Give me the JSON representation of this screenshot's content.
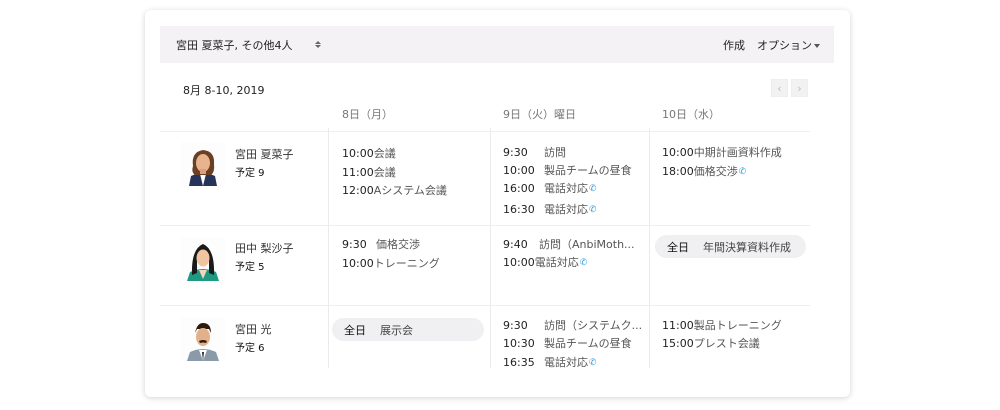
{
  "toolbar": {
    "people": "宮田 夏菜子, その他4人",
    "create": "作成",
    "options": "オプション"
  },
  "calendar": {
    "range": "8月 8-10, 2019",
    "prev": "‹",
    "next": "›",
    "days": [
      "8日（月）",
      "9日（火）曜日",
      "10日（水）"
    ]
  },
  "people": [
    {
      "name": "宮田 夏菜子",
      "count": "予定 9"
    },
    {
      "name": "田中 梨沙子",
      "count": "予定 5"
    },
    {
      "name": "宮田 光",
      "count": "予定 6"
    }
  ],
  "events": {
    "r0": {
      "d0": [
        {
          "time": "10:00",
          "label": "会議"
        },
        {
          "time": "11:00",
          "label": "会議"
        },
        {
          "time": "12:00",
          "label": "Aシステム会議"
        }
      ],
      "d1": [
        {
          "time": "9:30",
          "label": "訪問"
        },
        {
          "time": "10:00",
          "label": "製品チームの昼食"
        },
        {
          "time": "16:00",
          "label": "電話対応",
          "icon": "phone-icon"
        },
        {
          "time": "16:30",
          "label": "電話対応",
          "icon": "phone-icon"
        }
      ],
      "d2": [
        {
          "time": "10:00",
          "label": "中期計画資料作成"
        },
        {
          "time": "18:00",
          "label": "価格交渉",
          "icon": "phone-icon"
        }
      ]
    },
    "r1": {
      "d0": [
        {
          "time": "9:30",
          "label": "価格交渉"
        },
        {
          "time": "10:00",
          "label": "トレーニング"
        }
      ],
      "d1": [
        {
          "time": "9:40",
          "label": "訪問（AnbiMoth..."
        },
        {
          "time": "10:00",
          "label": "電話対応",
          "icon": "phone-icon"
        }
      ],
      "d2_allday": {
        "tag": "全日",
        "label": "年間決算資料作成"
      }
    },
    "r2": {
      "d0_allday": {
        "tag": "全日",
        "label": "展示会"
      },
      "d1": [
        {
          "time": "9:30",
          "label": "訪問（システムク..."
        },
        {
          "time": "10:30",
          "label": "製品チームの昼食"
        },
        {
          "time": "16:35",
          "label": "電話対応",
          "icon": "phone-icon"
        }
      ],
      "d2": [
        {
          "time": "11:00",
          "label": "製品トレーニング"
        },
        {
          "time": "15:00",
          "label": "プレスト会議"
        }
      ]
    }
  },
  "colors": {
    "toolbar_bg": "#f4f2f4",
    "allday_bg": "#f0eff1",
    "phone": "#3aa0d8"
  }
}
